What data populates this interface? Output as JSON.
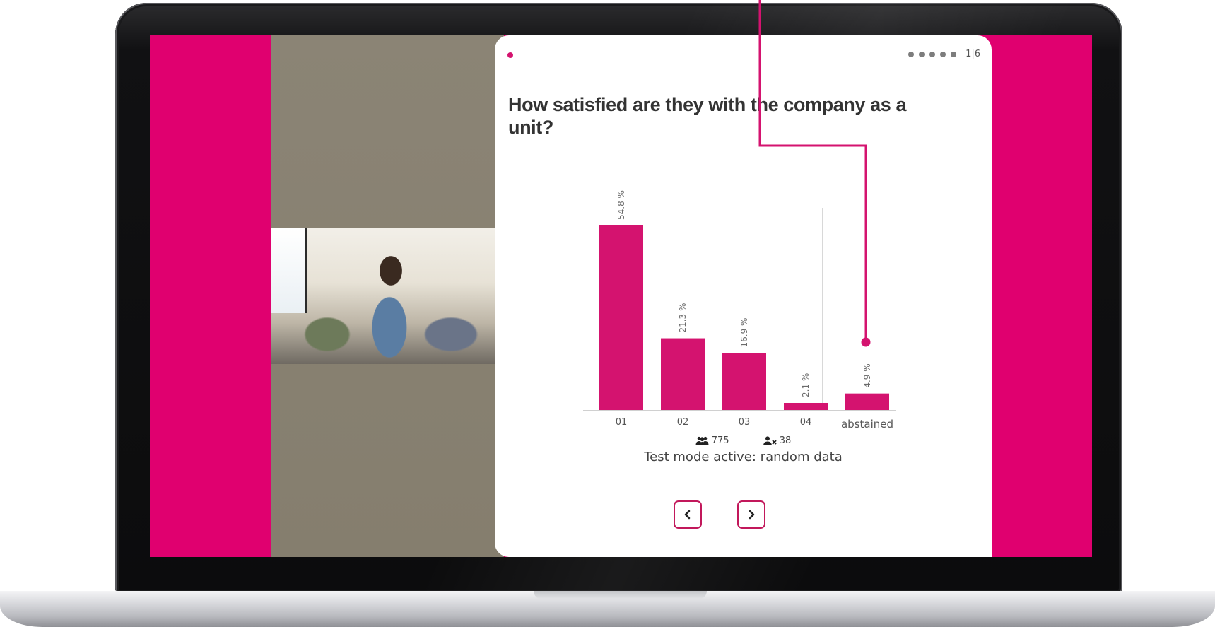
{
  "app": {
    "question": "How satisfied are they with the company as a unit?",
    "pager": {
      "dots": 5,
      "label": "1|6"
    },
    "stats": {
      "participants": "775",
      "abstained": "38"
    },
    "test_note": "Test mode active: random data",
    "nav": {
      "prev_icon": "chevron-left-icon",
      "next_icon": "chevron-right-icon"
    },
    "photo": {
      "description_icon": "team-photo"
    }
  },
  "colors": {
    "accent": "#e0006f",
    "bar": "#d4136f",
    "photo_bg": "#877f70"
  },
  "chart_data": {
    "type": "bar",
    "categories": [
      "01",
      "02",
      "03",
      "04",
      "abstained"
    ],
    "values": [
      54.8,
      21.3,
      16.9,
      2.1,
      4.9
    ],
    "value_labels": [
      "54.8 %",
      "21.3 %",
      "16.9 %",
      "2.1 %",
      "4.9 %"
    ],
    "unit": "%",
    "ylim": [
      0,
      60
    ],
    "grid": false
  }
}
